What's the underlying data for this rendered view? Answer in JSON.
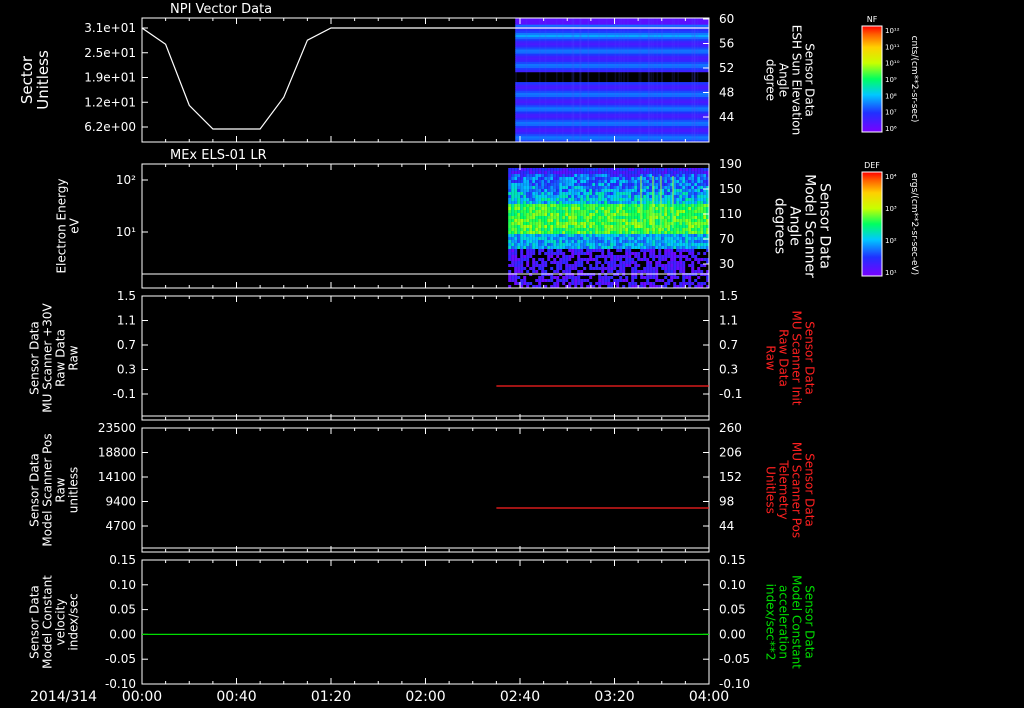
{
  "chart_data": [
    {
      "type": "line",
      "title": "NPI Vector Data",
      "ylabel": [
        "Sector",
        "Unitless"
      ],
      "y_ticks": [
        "3.1e+01",
        "2.5e+01",
        "1.9e+01",
        "1.2e+01",
        "6.2e+00"
      ],
      "right_label": [
        "Sensor Data",
        "ESH Sun Elevation",
        "Angle",
        "degree"
      ],
      "right_ticks": [
        "60",
        "56",
        "52",
        "48",
        "44"
      ],
      "series": [
        {
          "label": "",
          "x": [
            0,
            10,
            20,
            30,
            40,
            50,
            60,
            70,
            80,
            90,
            100,
            110,
            120,
            130,
            140,
            150,
            160,
            170,
            180,
            190,
            200,
            210,
            220,
            230,
            240
          ],
          "y": [
            31,
            27,
            12,
            6.2,
            6.2,
            6.2,
            14,
            28,
            31,
            31,
            31,
            31,
            31,
            31,
            31,
            31,
            31,
            31,
            31,
            31,
            31,
            31,
            31,
            31,
            31
          ]
        }
      ],
      "spectrogram": {
        "start_min": 158,
        "end_min": 240,
        "gaps_deg": [
          [
            49.5,
            51.5
          ]
        ],
        "colorbar_label": "NF",
        "colorbar_ticks": [
          "10¹²",
          "10¹¹",
          "10¹⁰",
          "10⁹",
          "10⁸",
          "10⁷",
          "10⁶"
        ],
        "colorbar_units": "cnts/(cm**2-sr-sec)"
      }
    },
    {
      "type": "heatmap",
      "title": "MEx ELS-01 LR",
      "ylabel": [
        "Electron Energy",
        "eV"
      ],
      "y_ticks": [
        "10²",
        "10¹"
      ],
      "right_label": [
        "Sensor Data",
        "Model Scanner",
        "Angle",
        "degrees"
      ],
      "right_ticks": [
        "190",
        "150",
        "110",
        "70",
        "30"
      ],
      "spectrogram": {
        "start_min": 155,
        "end_min": 240
      },
      "series": [
        {
          "label": "",
          "x": [
            0,
            240
          ],
          "y": [
            3.5,
            3.5
          ]
        }
      ],
      "colorbar_label": "DEF",
      "colorbar_ticks": [
        "10⁴",
        "10³",
        "10²",
        "10¹"
      ],
      "colorbar_units": "ergs/(cm**2-sr-sec-eV)"
    },
    {
      "type": "line",
      "ylabel": [
        "Sensor Data",
        "MU Scanner +30V",
        "Raw Data",
        "Raw"
      ],
      "y_ticks": [
        "1.5",
        "1.1",
        "0.7",
        "0.3",
        "-0.1"
      ],
      "right_label": [
        "Sensor Data",
        "MU Scanner Init",
        "Raw Data",
        "Raw"
      ],
      "right_ticks": [
        "1.5",
        "1.1",
        "0.7",
        "0.3",
        "-0.1"
      ],
      "series": [
        {
          "label": "",
          "color": "#ff2020",
          "x": [
            150,
            240
          ],
          "y": [
            0.0,
            0.0
          ]
        }
      ]
    },
    {
      "type": "line",
      "ylabel": [
        "Sensor Data",
        "Model Scanner Pos",
        "Raw",
        "unitless"
      ],
      "y_ticks": [
        "23500",
        "18800",
        "14100",
        "9400",
        "4700"
      ],
      "right_label": [
        "Sensor Data",
        "MU Scanner Pos",
        "Telemetry",
        "Unitless"
      ],
      "right_ticks": [
        "260",
        "206",
        "152",
        "98",
        "44"
      ],
      "series": [
        {
          "label": "",
          "color": "#ff2020",
          "x": [
            150,
            240
          ],
          "y": [
            8000,
            8000
          ]
        }
      ]
    },
    {
      "type": "line",
      "ylabel": [
        "Sensor Data",
        "Model Constant",
        "velocity",
        "index/sec"
      ],
      "y_ticks": [
        "0.15",
        "0.10",
        "0.05",
        "0.00",
        "-0.05",
        "-0.10"
      ],
      "right_label": [
        "Sensor Data",
        "Model Constant",
        "acceleration",
        "index/sec**2"
      ],
      "right_ticks": [
        "0.15",
        "0.10",
        "0.05",
        "0.00",
        "-0.05",
        "-0.10"
      ],
      "series": [
        {
          "label": "",
          "color": "#00dd00",
          "x": [
            0,
            240
          ],
          "y": [
            0.0,
            0.0
          ]
        }
      ]
    }
  ],
  "x_axis": {
    "date_label": "2014/314",
    "ticks": [
      "00:00",
      "00:40",
      "01:20",
      "02:00",
      "02:40",
      "03:20",
      "04:00"
    ],
    "range_min": [
      0,
      240
    ]
  }
}
